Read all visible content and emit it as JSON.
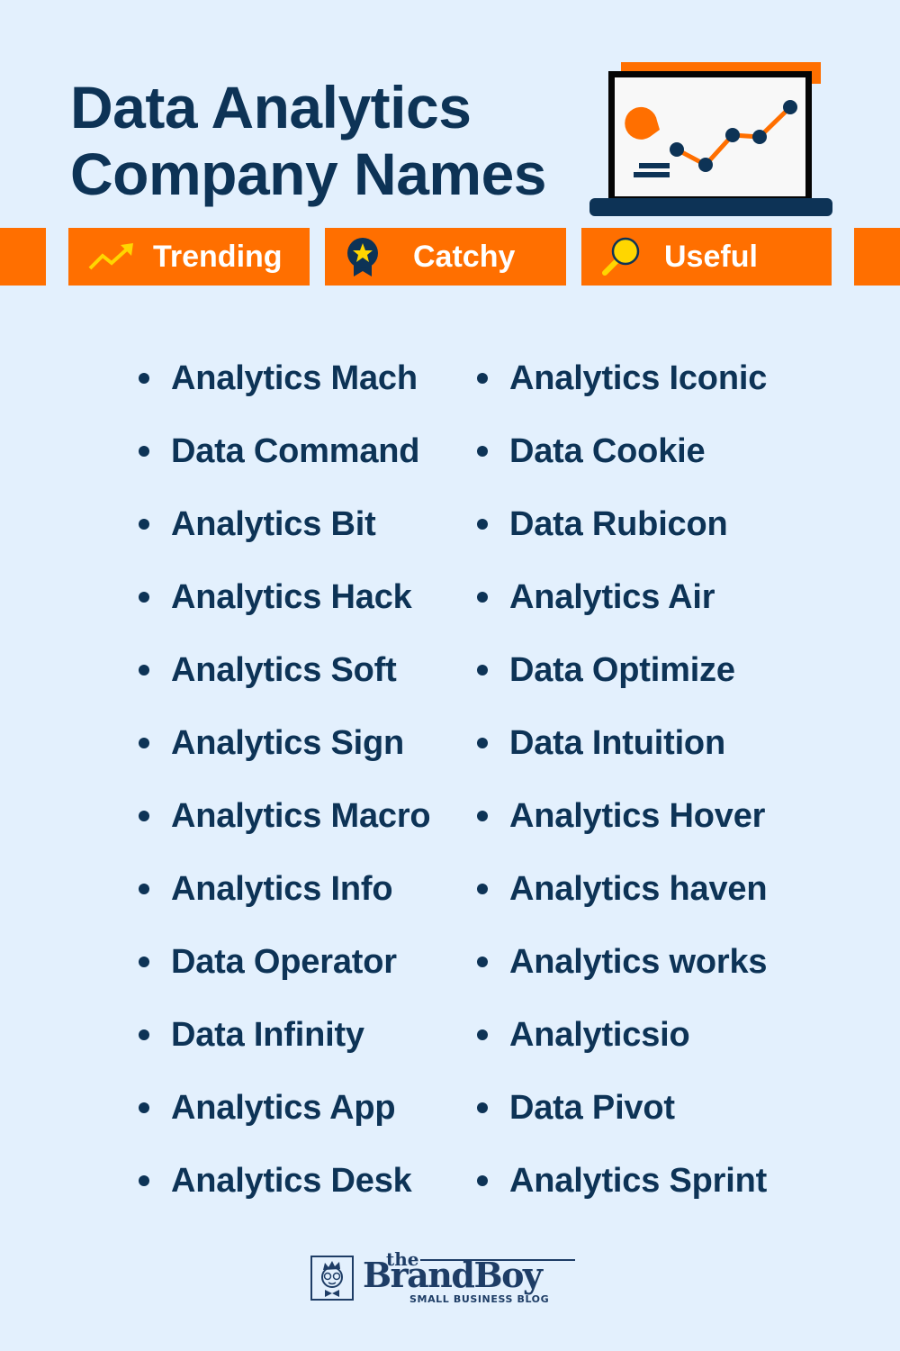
{
  "header": {
    "title_line1": "Data Analytics",
    "title_line2": "Company Names",
    "illustration": "laptop-chart-icon"
  },
  "tags": [
    {
      "label": "Trending",
      "icon": "trending-up-icon"
    },
    {
      "label": "Catchy",
      "icon": "award-star-icon"
    },
    {
      "label": "Useful",
      "icon": "magnifier-icon"
    }
  ],
  "names": {
    "left": [
      "Analytics Mach",
      "Data Command",
      "Analytics Bit",
      "Analytics Hack",
      "Analytics Soft",
      "Analytics Sign",
      "Analytics Macro",
      "Analytics Info",
      "Data Operator",
      "Data Infinity",
      "Analytics App",
      "Analytics Desk"
    ],
    "right": [
      "Analytics Iconic",
      "Data Cookie",
      "Data Rubicon",
      "Analytics Air",
      "Data Optimize",
      "Data Intuition",
      "Analytics Hover",
      "Analytics haven",
      "Analytics works",
      "Analyticsio",
      "Data Pivot",
      "Analytics Sprint"
    ]
  },
  "footer": {
    "logo_the": "the",
    "logo_brand": "BrandBoy",
    "logo_tagline": "SMALL BUSINESS BLOG"
  },
  "colors": {
    "background": "#e3f0fd",
    "navy": "#0d3356",
    "orange": "#ff6f00",
    "yellow": "#ffd600"
  }
}
